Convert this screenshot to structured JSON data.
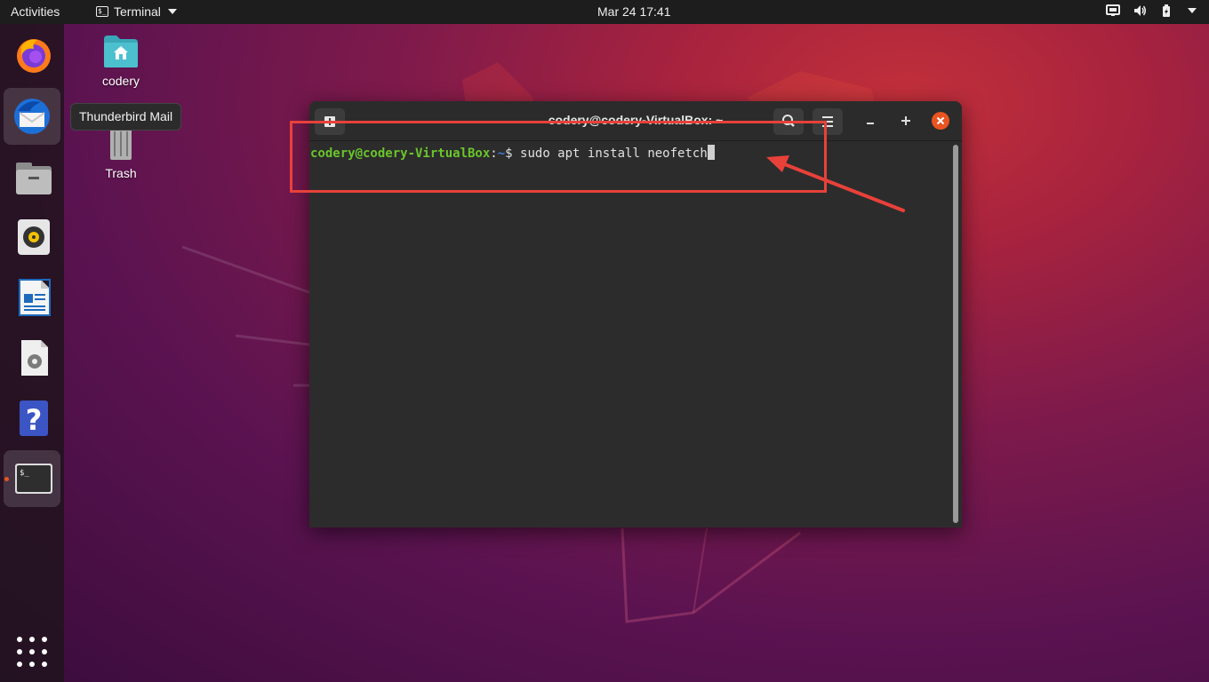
{
  "topbar": {
    "activities": "Activities",
    "app_name": "Terminal",
    "clock": "Mar 24  17:41"
  },
  "dock": {
    "items": [
      "firefox",
      "thunderbird-mail",
      "files",
      "rhythmbox",
      "libreoffice-writer",
      "software",
      "help",
      "terminal"
    ],
    "tooltip": "Thunderbird Mail"
  },
  "desktop": {
    "icons": [
      {
        "label": "codery",
        "icon": "home-folder-icon"
      },
      {
        "label": "Trash",
        "icon": "trash-icon"
      }
    ]
  },
  "terminal": {
    "title": "codery@codery-VirtualBox: ~",
    "prompt_user": "codery@codery-VirtualBox",
    "prompt_sep": ":",
    "prompt_path": "~",
    "prompt_dollar": "$ ",
    "command": "sudo apt install neofetch"
  },
  "colors": {
    "accent": "#e95420",
    "annotation": "#e8413a",
    "prompt_user": "#6ac52b",
    "prompt_path": "#3d7ad9"
  }
}
